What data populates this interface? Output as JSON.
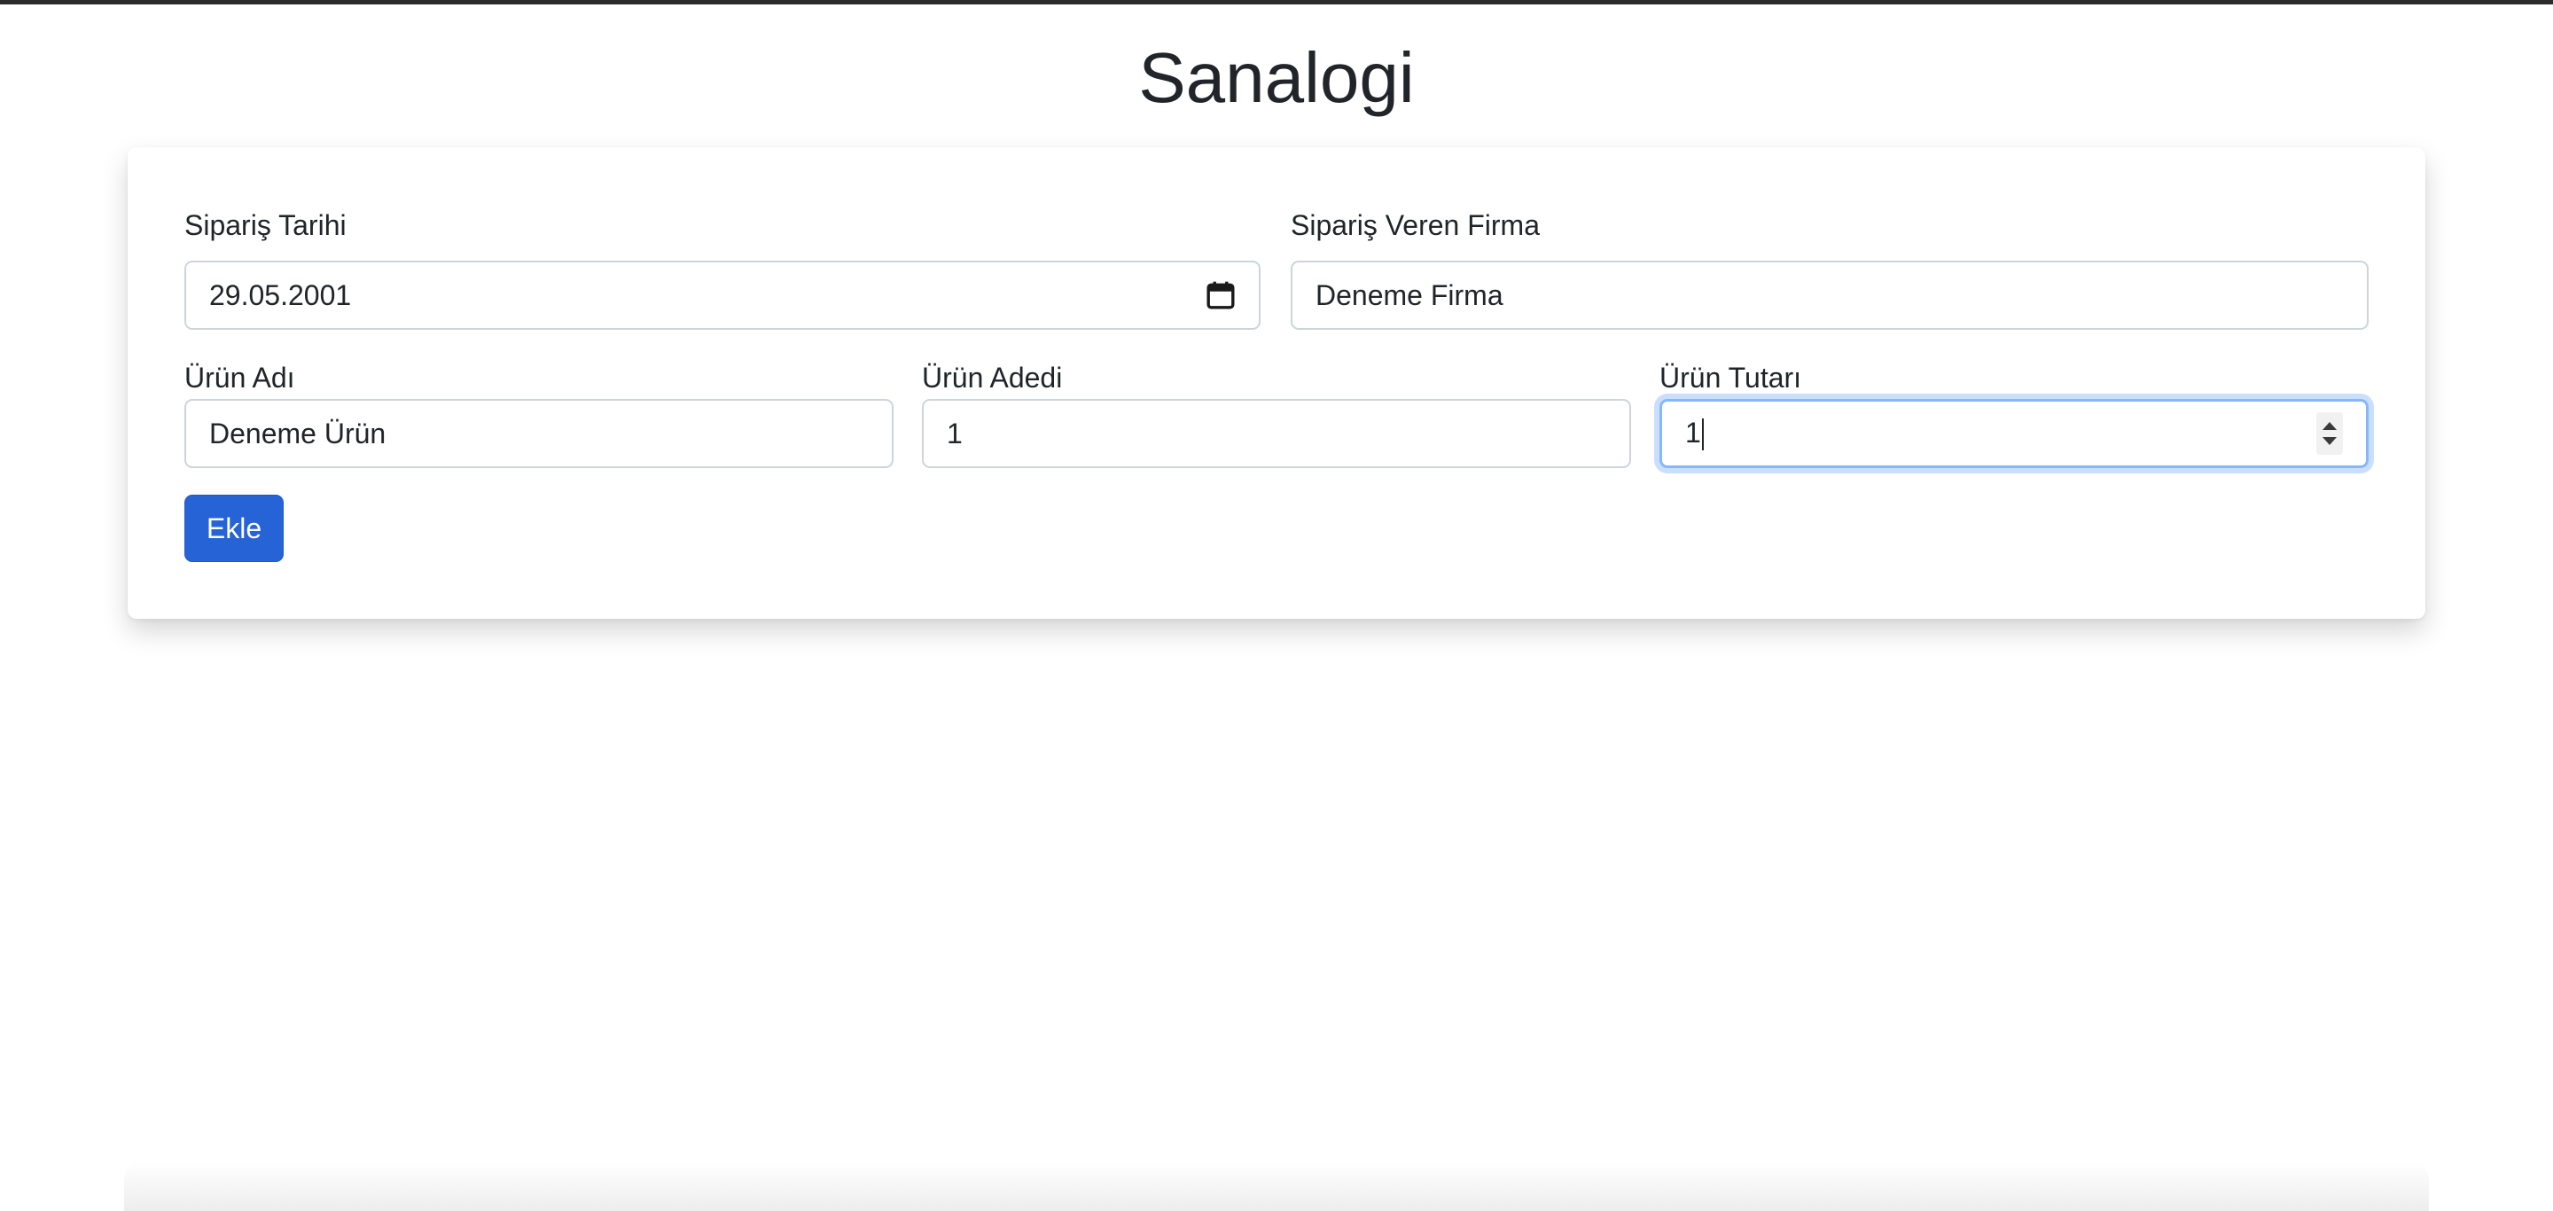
{
  "page": {
    "title": "Sanalogi"
  },
  "form": {
    "order_date": {
      "label": "Sipariş Tarihi",
      "value": "29.05.2001",
      "icon": "calendar-icon"
    },
    "company": {
      "label": "Sipariş Veren Firma",
      "value": "Deneme Firma"
    },
    "product_name": {
      "label": "Ürün Adı",
      "value": "Deneme Ürün"
    },
    "product_quantity": {
      "label": "Ürün Adedi",
      "value": "1"
    },
    "product_price": {
      "label": "Ürün Tutarı",
      "value": "1",
      "focused": true
    },
    "submit_label": "Ekle"
  },
  "colors": {
    "primary": "#2563d6",
    "focus_ring": "#86b7fe",
    "border": "#ced4da",
    "text": "#212529"
  }
}
